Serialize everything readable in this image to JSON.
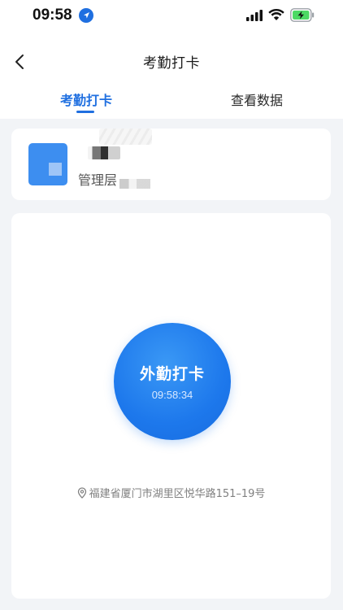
{
  "status_bar": {
    "time": "09:58",
    "icons": [
      "location-arrow-icon",
      "signal-icon",
      "wifi-icon",
      "battery-charging-icon"
    ]
  },
  "nav": {
    "title": "考勤打卡",
    "back_icon": "chevron-left-icon"
  },
  "tabs": [
    {
      "label": "考勤打卡",
      "active": true
    },
    {
      "label": "查看数据",
      "active": false
    }
  ],
  "profile": {
    "role": "管理层"
  },
  "punch": {
    "label": "外勤打卡",
    "time": "09:58:34"
  },
  "location": {
    "icon": "map-pin-icon",
    "address": "福建省厦门市湖里区悦华路151–19号"
  },
  "colors": {
    "accent": "#1f6fe0",
    "button": "#1d78ec",
    "background": "#f2f4f7",
    "battery": "#4cd964"
  }
}
